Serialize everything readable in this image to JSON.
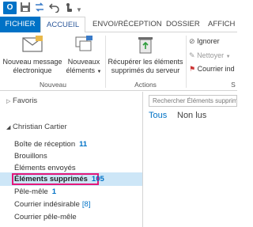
{
  "titlebar": {
    "app_icon_letter": "O",
    "quick_access_icons": [
      "save-icon",
      "send-receive-icon",
      "undo-icon",
      "touch-mode-icon",
      "customize-qat-icon"
    ]
  },
  "tabs": {
    "file": "FICHIER",
    "home": "ACCUEIL",
    "send_receive": "ENVOI/RÉCEPTION",
    "folder": "DOSSIER",
    "view": "AFFICH"
  },
  "ribbon": {
    "new_email_line1": "Nouveau message",
    "new_email_line2": "électronique",
    "new_items_line1": "Nouveaux",
    "new_items_line2": "éléments",
    "group_new": "Nouveau",
    "recover_line1": "Récupérer les éléments",
    "recover_line2": "supprimés du serveur",
    "group_actions": "Actions",
    "ignore": "Ignorer",
    "cleanup": "Nettoyer",
    "junk": "Courrier ind",
    "group_delete_partial": "S"
  },
  "nav": {
    "favorites": "Favoris",
    "account": "Christian Cartier",
    "folders": [
      {
        "name": "Boîte de réception",
        "count": "11"
      },
      {
        "name": "Brouillons",
        "count": ""
      },
      {
        "name": "Éléments envoyés",
        "count": ""
      },
      {
        "name": "Éléments supprimés",
        "count": "105"
      },
      {
        "name": "Pêle-mêle",
        "count": "1"
      },
      {
        "name": "Courrier indésirable",
        "count": "[8]"
      },
      {
        "name": "Courrier pêle-mêle",
        "count": ""
      }
    ]
  },
  "list": {
    "search_placeholder": "Rechercher Éléments supprimés",
    "filter_all": "Tous",
    "filter_unread": "Non lus"
  },
  "colors": {
    "accent": "#0072c6",
    "selection": "#cde6f7",
    "highlight": "#e3187a"
  }
}
